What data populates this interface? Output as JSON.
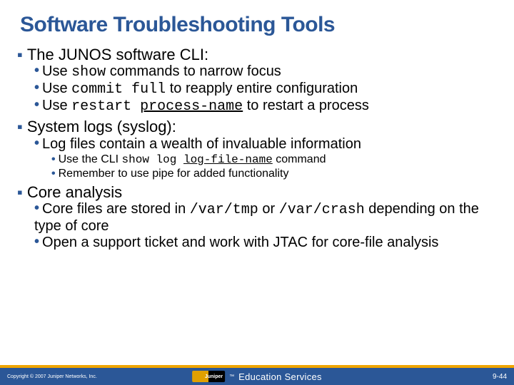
{
  "title": "Software Troubleshooting Tools",
  "sections": [
    {
      "heading": "The JUNOS software CLI:",
      "items_l2": [
        {
          "pre": "Use ",
          "code": "show",
          "post": " commands to narrow focus"
        },
        {
          "pre": "Use ",
          "code": "commit full",
          "post": " to reapply entire configuration"
        },
        {
          "pre": "Use ",
          "code": "restart ",
          "codeu": "process-name",
          "post": " to restart a process"
        }
      ]
    },
    {
      "heading": "System logs (syslog):",
      "items_l2": [
        {
          "pre": "Log files contain a wealth of invaluable information"
        }
      ],
      "items_l3": [
        {
          "pre": "Use the CLI ",
          "code": "show log ",
          "codeu": "log-file-name",
          "post": " command"
        },
        {
          "pre": "Remember to use pipe for added functionality"
        }
      ]
    },
    {
      "heading": "Core analysis",
      "items_l2": [
        {
          "pre": "Core files are stored in ",
          "code": "/var/tmp",
          "mid": " or ",
          "code2": "/var/crash",
          "post": " depending on the type of core"
        },
        {
          "pre": "Open a support ticket and work with JTAC for core-file analysis"
        }
      ]
    }
  ],
  "footer": {
    "copyright": "Copyright © 2007 Juniper Networks, Inc.",
    "brand": "Education Services",
    "page": "9-44"
  }
}
